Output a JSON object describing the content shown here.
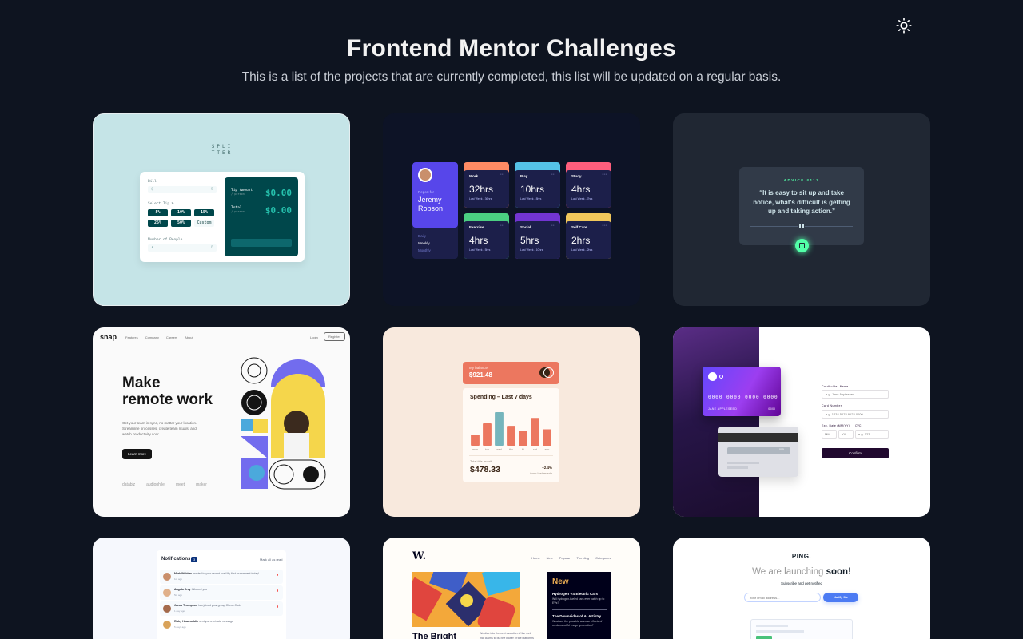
{
  "header": {
    "title": "Frontend Mentor Challenges",
    "subtitle": "This is a list of the projects that are currently completed, this list will be updated on a regular basis."
  },
  "colors": {
    "background": "#0e1420",
    "tip_teal": "#00474b",
    "time_purple": "#5746ea",
    "advice_green": "#52ffa8",
    "expenses_orange": "#ec775f",
    "card_purple": "#21092f"
  },
  "tip_calculator": {
    "logo_line1": "SPLI",
    "logo_line2": "TTER",
    "bill_label": "Bill",
    "bill_value": "0",
    "select_tip_label": "Select Tip %",
    "tips": [
      "5%",
      "10%",
      "15%",
      "25%",
      "50%",
      "Custom"
    ],
    "people_label": "Number of People",
    "people_value": "0",
    "tip_amount_label": "Tip Amount",
    "tip_amount_sub": "/ person",
    "tip_amount_value": "$0.00",
    "total_label": "Total",
    "total_sub": "/ person",
    "total_value": "$0.00"
  },
  "time_tracking": {
    "report_for": "Report for",
    "name_first": "Jeremy",
    "name_last": "Robson",
    "periods": [
      "Daily",
      "Weekly",
      "Monthly"
    ],
    "activities": [
      {
        "name": "Work",
        "hours": "32hrs",
        "last": "Last Week - 36hrs",
        "color": "#ff8b64"
      },
      {
        "name": "Play",
        "hours": "10hrs",
        "last": "Last Week - 8hrs",
        "color": "#55c2e6"
      },
      {
        "name": "Study",
        "hours": "4hrs",
        "last": "Last Week - 7hrs",
        "color": "#ff5e7d"
      },
      {
        "name": "Exercise",
        "hours": "4hrs",
        "last": "Last Week - 5hrs",
        "color": "#4bcf82"
      },
      {
        "name": "Social",
        "hours": "5hrs",
        "last": "Last Week - 10hrs",
        "color": "#7335d2"
      },
      {
        "name": "Self Care",
        "hours": "2hrs",
        "last": "Last Week - 2hrs",
        "color": "#f1c75b"
      }
    ]
  },
  "advice": {
    "label": "ADVICE #117",
    "quote": "“It is easy to sit up and take notice, what's difficult is getting up and taking action.”"
  },
  "snap": {
    "logo": "snap",
    "nav": [
      "Features",
      "Company",
      "Careers",
      "About"
    ],
    "login": "Login",
    "register": "Register",
    "headline_1": "Make",
    "headline_2": "remote work",
    "body": "Get your team in sync, no matter your location. Streamline processes, create team rituals, and watch productivity soar.",
    "cta": "Learn more",
    "clients": [
      "databiz",
      "audiophile",
      "meet",
      "maker"
    ]
  },
  "expenses": {
    "balance_label": "My balance",
    "balance": "$921.48",
    "title": "Spending – Last 7 days",
    "chart_data": {
      "type": "bar",
      "categories": [
        "mon",
        "tue",
        "wed",
        "thu",
        "fri",
        "sat",
        "sun"
      ],
      "values": [
        17.45,
        34.91,
        52.36,
        31.07,
        23.39,
        43.28,
        25.48
      ]
    },
    "total_label": "Total this month",
    "total": "$478.33",
    "change": "+2.4%",
    "change_label": "from last month"
  },
  "card_details": {
    "card_number": "0000 0000 0000 0000",
    "card_name": "JANE APPLESEED",
    "card_exp": "00/00",
    "card_cvc": "000",
    "name_label": "Cardholder Name",
    "name_placeholder": "e.g. Jane Appleseed",
    "number_label": "Card Number",
    "number_placeholder": "e.g. 1234 5678 9123 0000",
    "date_label": "Exp. Date (MM/YY)",
    "cvc_label": "CVC",
    "mm_placeholder": "MM",
    "yy_placeholder": "YY",
    "cvc_placeholder": "e.g. 123",
    "confirm": "Confirm"
  },
  "notifications": {
    "title": "Notifications",
    "count": "3",
    "mark_all": "Mark all as read",
    "items": [
      {
        "name": "Mark Webber",
        "text": "reacted to your recent post My first tournament today!",
        "time": "1m ago"
      },
      {
        "name": "Angela Gray",
        "text": "followed you",
        "time": "5m ago"
      },
      {
        "name": "Jacob Thompson",
        "text": "has joined your group Chess Club",
        "time": "1 day ago"
      },
      {
        "name": "Rizky Hasanuddin",
        "text": "sent you a private message",
        "time": "5 days ago"
      }
    ]
  },
  "news": {
    "logo": "W.",
    "nav": [
      "Home",
      "New",
      "Popular",
      "Trending",
      "Categories"
    ],
    "new_heading": "New",
    "new_items": [
      {
        "title": "Hydrogen VS Electric Cars",
        "text": "Will hydrogen-fueled cars ever catch up to EVs?"
      },
      {
        "title": "The Downsides of AI Artistry",
        "text": "What are the possible adverse effects of on-demand AI image generation?"
      }
    ],
    "headline": "The Bright",
    "body": "We dive into the next evolution of the web that claims to put the power of the platforms back into the hands of the people."
  },
  "ping": {
    "logo": "PING.",
    "headline_a": "We are launching",
    "headline_b": "soon!",
    "sub": "Subscribe and get notified",
    "placeholder": "Your email address...",
    "button": "Notify Me"
  }
}
